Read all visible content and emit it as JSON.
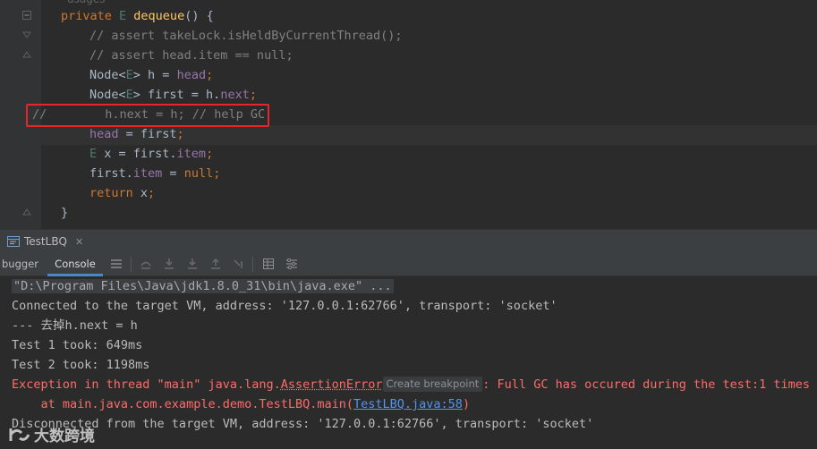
{
  "editor": {
    "partial_top": "usages",
    "lines": [
      {
        "parts": [
          [
            "kw",
            "private "
          ],
          [
            "tp",
            "E "
          ],
          [
            "fn",
            "dequeue"
          ],
          [
            "plain",
            "() {"
          ]
        ]
      },
      {
        "parts": [
          [
            "cm",
            "// assert takeLock.isHeldByCurrentThread();"
          ]
        ]
      },
      {
        "parts": [
          [
            "cm",
            "// assert head.item == null;"
          ]
        ]
      },
      {
        "parts": [
          [
            "plain",
            "Node<"
          ],
          [
            "tp",
            "E"
          ],
          [
            "plain",
            "> h = "
          ],
          [
            "field",
            "head"
          ],
          [
            "kw",
            ";"
          ]
        ]
      },
      {
        "parts": [
          [
            "plain",
            "Node<"
          ],
          [
            "tp",
            "E"
          ],
          [
            "plain",
            "> first = h."
          ],
          [
            "field",
            "next"
          ],
          [
            "kw",
            ";"
          ]
        ]
      },
      {
        "parts": [
          [
            "cm",
            "//        h.next = h; // help GC"
          ]
        ]
      },
      {
        "parts": [
          [
            "field",
            "head"
          ],
          [
            "plain",
            " = first"
          ],
          [
            "kw",
            ";"
          ]
        ]
      },
      {
        "parts": [
          [
            "tp",
            "E "
          ],
          [
            "plain",
            "x = first."
          ],
          [
            "field",
            "item"
          ],
          [
            "kw",
            ";"
          ]
        ]
      },
      {
        "parts": [
          [
            "plain",
            "first."
          ],
          [
            "field",
            "item"
          ],
          [
            "plain",
            " = "
          ],
          [
            "kw",
            "null;"
          ]
        ]
      },
      {
        "parts": [
          [
            "kw",
            "return "
          ],
          [
            "plain",
            "x"
          ],
          [
            "kw",
            ";"
          ]
        ]
      },
      {
        "parts": [
          [
            "plain",
            "}"
          ]
        ]
      }
    ]
  },
  "tool_window": {
    "run_tab_label": "TestLBQ",
    "tabs": [
      "bugger",
      "Console"
    ],
    "active_tab": "Console"
  },
  "console": {
    "line_cmd": "\"D:\\Program Files\\Java\\jdk1.8.0_31\\bin\\java.exe\" ...",
    "line_connected": "Connected to the target VM, address: '127.0.0.1:62766', transport: 'socket'",
    "line_removed": "--- 去掉h.next = h",
    "line_test1": "Test 1 took: 649ms",
    "line_test2": "Test 2 took: 1198ms",
    "exception_prefix": "Exception in thread \"main\" java.lang.",
    "exception_class": "AssertionError",
    "create_breakpoint": "Create breakpoint",
    "exception_msg": ": Full GC has occured during the test:1 times",
    "stack_prefix": "    at main.java.com.example.demo.TestLBQ.main(",
    "stack_link": "TestLBQ.java:58",
    "stack_suffix": ")",
    "line_disconnected": "Disconnected from the target VM, address: '127.0.0.1:62766', transport: 'socket'"
  },
  "watermark": "大数跨境",
  "colors": {
    "accent": "#4a88c7",
    "error": "#ff6b68",
    "keyword": "#cc7832",
    "highlight_border": "#e8262a"
  }
}
